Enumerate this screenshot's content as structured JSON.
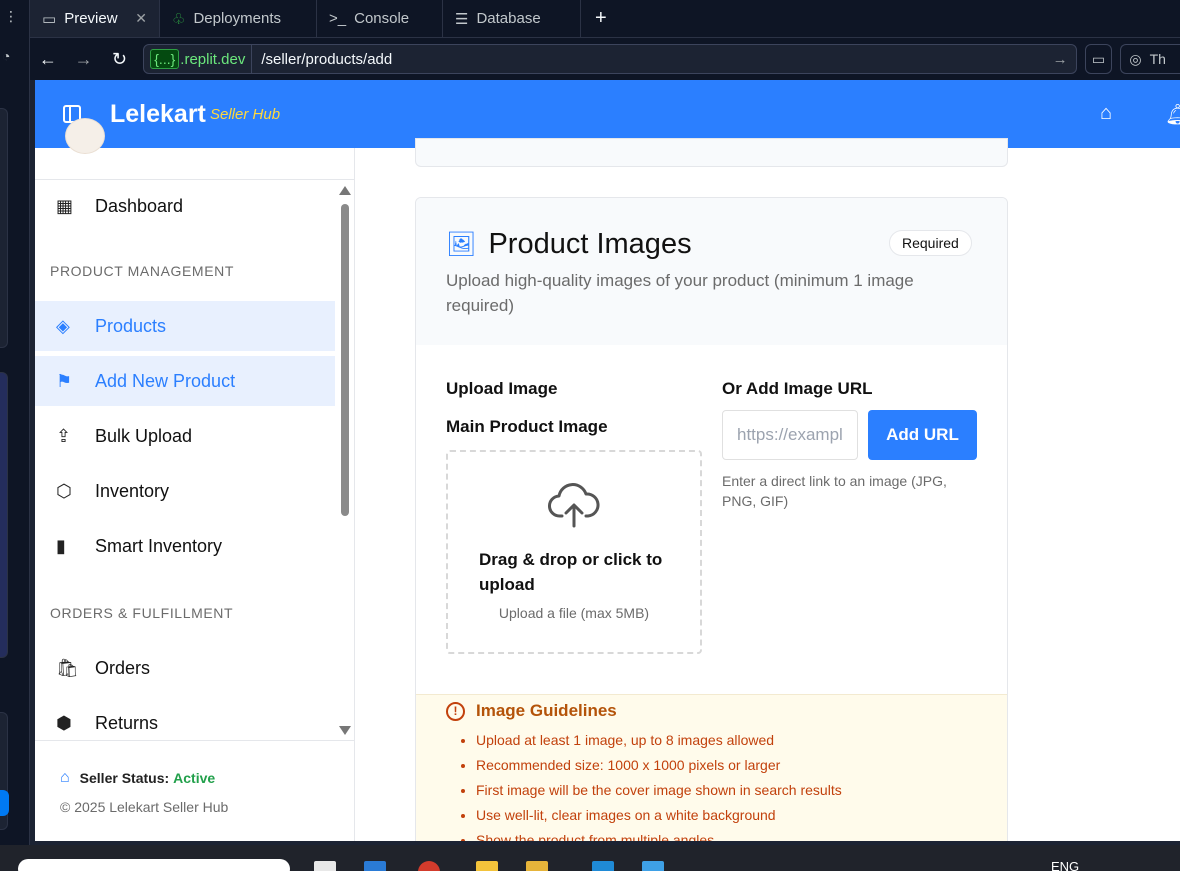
{
  "ide": {
    "tabs": [
      {
        "label": "Preview",
        "icon": "monitor-icon"
      },
      {
        "label": "Deployments",
        "icon": "tree-icon"
      },
      {
        "label": "Console",
        "icon": "terminal-icon"
      },
      {
        "label": "Database",
        "icon": "database-icon"
      }
    ],
    "url_chip": "{...}",
    "url_domain": ".replit.dev",
    "url_path": "/seller/products/add",
    "theme_label": "Th"
  },
  "app": {
    "brand": "Lelekart",
    "brand_sub": "Seller Hub",
    "colors": {
      "primary": "#2b7fff",
      "brand_sub": "#ffd93d",
      "active": "#22a04b",
      "warning": "#b45309"
    }
  },
  "sidebar": {
    "items_top": [
      {
        "label": "Dashboard",
        "icon": "grid-icon"
      }
    ],
    "section_product": "PRODUCT MANAGEMENT",
    "product_items": [
      {
        "label": "Products",
        "icon": "layers-icon",
        "selected": true
      },
      {
        "label": "Add New Product",
        "icon": "bookmark-icon",
        "selected": true
      },
      {
        "label": "Bulk Upload",
        "icon": "upload-icon",
        "selected": false
      },
      {
        "label": "Inventory",
        "icon": "box-icon",
        "selected": false
      },
      {
        "label": "Smart Inventory",
        "icon": "bar-chart-icon",
        "selected": false
      }
    ],
    "section_orders": "ORDERS & FULFILLMENT",
    "order_items": [
      {
        "label": "Orders",
        "icon": "shopping-bag-icon"
      },
      {
        "label": "Returns",
        "icon": "package-icon"
      }
    ],
    "status_label": "Seller Status:",
    "status_value": "Active",
    "copyright": "© 2025 Lelekart Seller Hub"
  },
  "main": {
    "card_title": "Product Images",
    "required_badge": "Required",
    "card_desc": "Upload high-quality images of your product (minimum 1 image required)",
    "upload_label": "Upload Image",
    "main_image_label": "Main Product Image",
    "dropzone_title": "Drag & drop or click to upload",
    "dropzone_sub": "Upload a file (max 5MB)",
    "url_label": "Or Add Image URL",
    "url_placeholder": "https://example.com/image.jpg",
    "add_url_button": "Add URL",
    "url_hint": "Enter a direct link to an image (JPG, PNG, GIF)",
    "guidelines_title": "Image Guidelines",
    "guidelines": [
      "Upload at least 1 image, up to 8 images allowed",
      "Recommended size: 1000 x 1000 pixels or larger",
      "First image will be the cover image shown in search results",
      "Use well-lit, clear images on a white background",
      "Show the product from multiple angles"
    ]
  },
  "taskbar": {
    "language": "ENG"
  }
}
